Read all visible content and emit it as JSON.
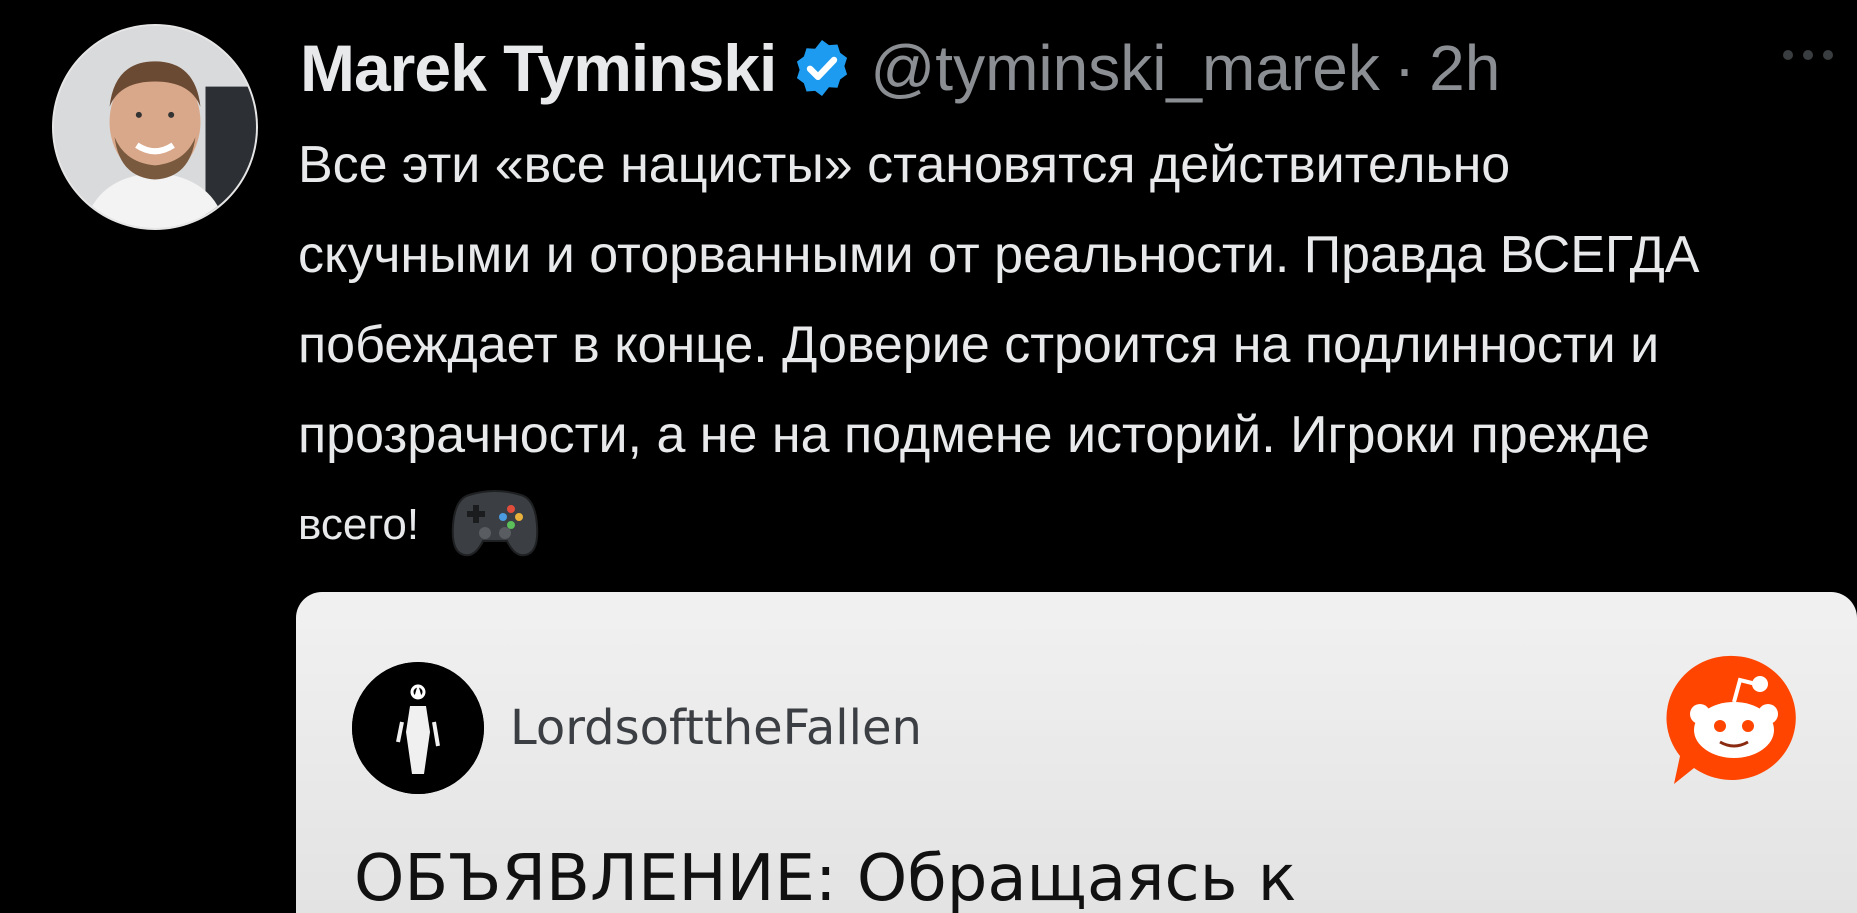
{
  "tweet": {
    "author_name": "Marek Tyminski",
    "handle": "@tyminski_marek",
    "separator": "·",
    "timestamp": "2h",
    "text_lines": [
      "Все эти «все нацисты» становятся действительно",
      "скучными и оторванными от реальности. Правда ВСЕГДА",
      "побеждает в конце. Доверие строится на подлинности и",
      "прозрачности, а не на подмене историй. Игроки прежде",
      "всего!"
    ],
    "emoji": "video-game-controller-icon"
  },
  "embedded_card": {
    "account_name": "LordsofttheFallen",
    "headline": "ОБЪЯВЛЕНИЕ: Обращаясь к",
    "brand_icon": "reddit-icon"
  },
  "colors": {
    "background": "#000000",
    "text_primary": "#e7e9ea",
    "text_secondary": "#8b8f93",
    "verified_blue": "#1d9bf0",
    "reddit_orange": "#ff4500"
  }
}
